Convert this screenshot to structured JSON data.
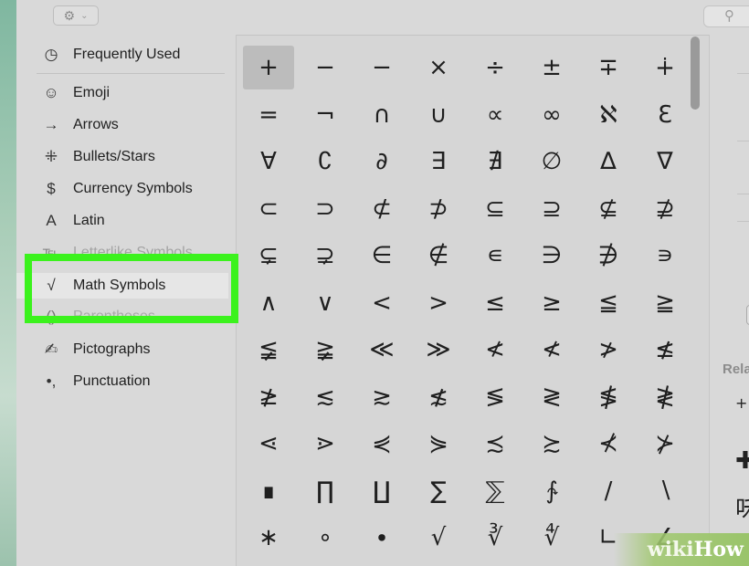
{
  "toolbar": {
    "gear_icon": "⚙",
    "chevron_icon": "⌄",
    "search_icon": "🔍"
  },
  "sidebar": {
    "items": [
      {
        "icon": "◷",
        "label": "Frequently Used"
      },
      {
        "icon": "☺",
        "label": "Emoji"
      },
      {
        "icon": "→",
        "label": "Arrows"
      },
      {
        "icon": "⁜",
        "label": "Bullets/Stars"
      },
      {
        "icon": "$",
        "label": "Currency Symbols"
      },
      {
        "icon": "A",
        "label": "Latin"
      },
      {
        "icon": "℡",
        "label": "Letterlike Symbols"
      },
      {
        "icon": "√",
        "label": "Math Symbols"
      },
      {
        "icon": "()",
        "label": "Parentheses"
      },
      {
        "icon": "✍",
        "label": "Pictographs"
      },
      {
        "icon": "•,",
        "label": "Punctuation"
      }
    ],
    "selected_index": 7
  },
  "symbols": [
    [
      "+",
      "−",
      "−",
      "×",
      "÷",
      "±",
      "∓",
      "∔"
    ],
    [
      "=",
      "¬",
      "∩",
      "∪",
      "∝",
      "∞",
      "ℵ",
      "ℇ"
    ],
    [
      "∀",
      "∁",
      "∂",
      "∃",
      "∄",
      "∅",
      "∆",
      "∇"
    ],
    [
      "⊂",
      "⊃",
      "⊄",
      "⊅",
      "⊆",
      "⊇",
      "⊈",
      "⊉"
    ],
    [
      "⊊",
      "⊋",
      "∈",
      "∉",
      "∊",
      "∋",
      "∌",
      "∍"
    ],
    [
      "∧",
      "∨",
      "<",
      ">",
      "≤",
      "≥",
      "≦",
      "≧"
    ],
    [
      "≨",
      "≩",
      "≪",
      "≫",
      "≮",
      "≮",
      "≯",
      "≰"
    ],
    [
      "≱",
      "≲",
      "≳",
      "≴",
      "≶",
      "≷",
      "≸",
      "≹"
    ],
    [
      "⋖",
      "⋗",
      "⋞",
      "⋟",
      "≾",
      "≿",
      "⊀",
      "⊁"
    ],
    [
      "∎",
      "∏",
      "∐",
      "∑",
      "⅀",
      "∱",
      "∕",
      "∖"
    ],
    [
      "∗",
      "∘",
      "∙",
      "√",
      "∛",
      "∜",
      "∟",
      "∠"
    ]
  ],
  "right_panel": {
    "related_label": "Relate",
    "related": [
      "+",
      "✚",
      "咊"
    ]
  },
  "watermark": {
    "part_a": "wiki",
    "part_b": "How"
  },
  "colors": {
    "highlight": "#3bf21d",
    "selected_cell": "#bcbcbc"
  }
}
